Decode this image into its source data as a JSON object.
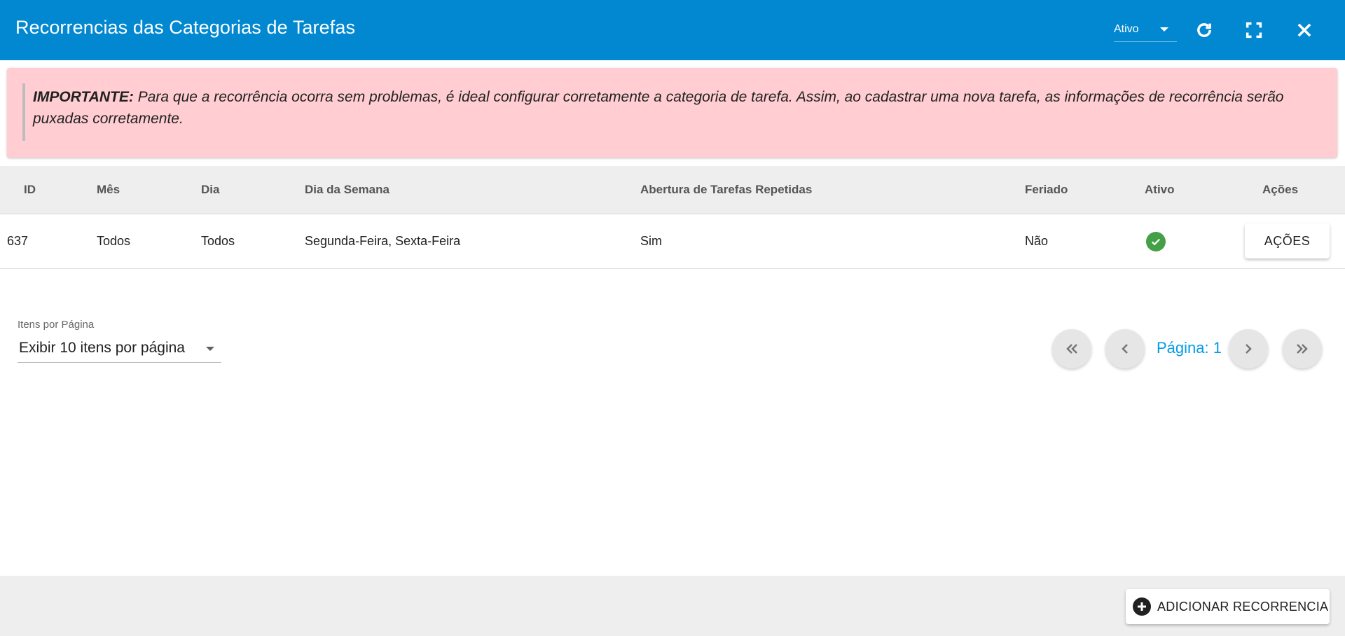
{
  "header": {
    "title": "Recorrencias das Categorias de Tarefas",
    "status_value": "Ativo",
    "icons": [
      "refresh-icon",
      "fullscreen-icon",
      "close-icon"
    ],
    "background_color": "#0288d1"
  },
  "alert": {
    "strong": "IMPORTANTE:",
    "text": " Para que a recorrência ocorra sem problemas, é ideal configurar corretamente a categoria de tarefa. Assim, ao cadastrar uma nova tarefa, as informações de recorrência serão puxadas corretamente.",
    "background_color": "#ffcdd2"
  },
  "table": {
    "columns": {
      "id": "ID",
      "mes": "Mês",
      "dia": "Dia",
      "dia_semana": "Dia da Semana",
      "abertura": "Abertura de Tarefas Repetidas",
      "feriado": "Feriado",
      "ativo": "Ativo",
      "acoes": "Ações"
    },
    "rows": [
      {
        "id": "637",
        "mes": "Todos",
        "dia": "Todos",
        "dia_semana": "Segunda-Feira, Sexta-Feira",
        "abertura": "Sim",
        "feriado": "Não",
        "ativo_icon": "check-circle-icon",
        "acoes_label": "AÇÕES"
      }
    ]
  },
  "pagination": {
    "per_page_label": "Itens por Página",
    "per_page_value": "Exibir 10 itens por página",
    "page_label": "Página: 1",
    "icons": [
      "first-page-icon",
      "prev-page-icon",
      "next-page-icon",
      "last-page-icon"
    ],
    "accent_color": "#039be5"
  },
  "footer": {
    "add_label": "ADICIONAR RECORRENCIA",
    "add_icon": "plus-circle-icon"
  }
}
